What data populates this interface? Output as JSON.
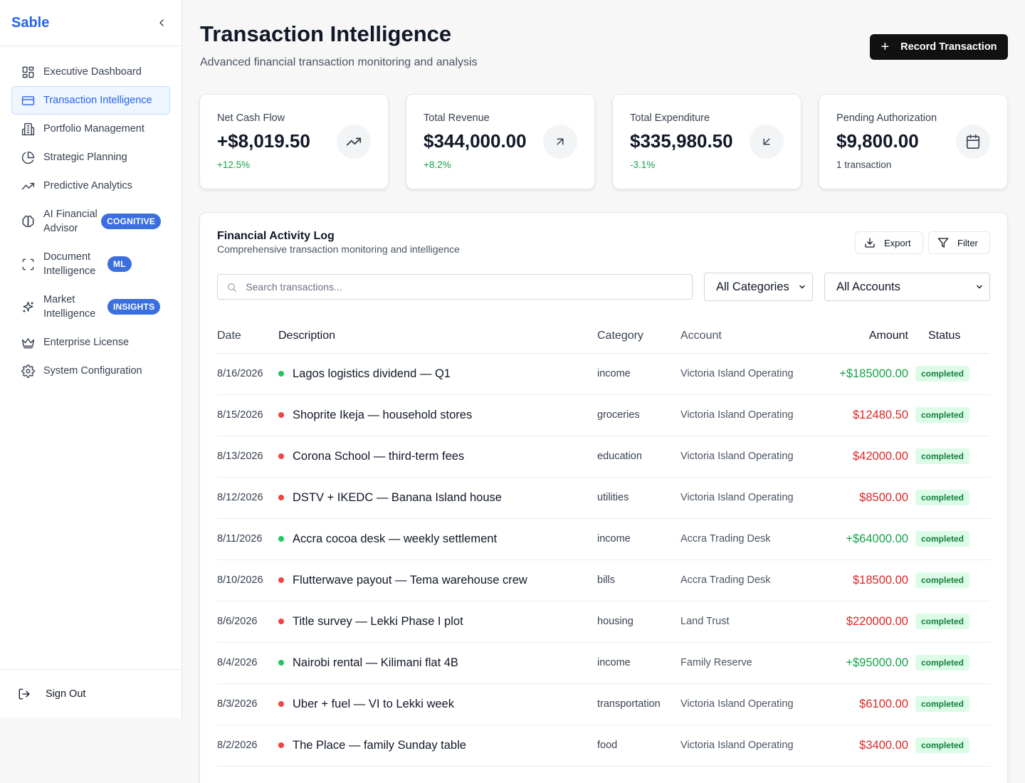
{
  "sidebar": {
    "brand": "Sable",
    "items": [
      {
        "label": "Executive Dashboard",
        "icon": "dashboard-icon",
        "active": false
      },
      {
        "label": "Transaction Intelligence",
        "icon": "credit-card-icon",
        "active": true
      },
      {
        "label": "Portfolio Management",
        "icon": "building-icon",
        "active": false
      },
      {
        "label": "Strategic Planning",
        "icon": "pie-chart-icon",
        "active": false
      },
      {
        "label": "Predictive Analytics",
        "icon": "trending-up-icon",
        "active": false
      },
      {
        "label": "AI Financial Advisor",
        "icon": "brain-icon",
        "badge": "COGNITIVE"
      },
      {
        "label": "Document Intelligence",
        "icon": "scan-icon",
        "badge": "ML"
      },
      {
        "label": "Market Intelligence",
        "icon": "sparkles-icon",
        "badge": "INSIGHTS"
      },
      {
        "label": "Enterprise License",
        "icon": "crown-icon"
      },
      {
        "label": "System Configuration",
        "icon": "gear-icon"
      }
    ],
    "sign_out": "Sign Out"
  },
  "header": {
    "title": "Transaction Intelligence",
    "subtitle": "Advanced financial transaction monitoring and analysis",
    "record_button": "Record Transaction"
  },
  "stats": [
    {
      "label": "Net Cash Flow",
      "value": "+$8,019.50",
      "change": "+12.5%",
      "icon": "trending-up-icon"
    },
    {
      "label": "Total Revenue",
      "value": "$344,000.00",
      "change": "+8.2%",
      "icon": "arrow-up-right-icon"
    },
    {
      "label": "Total Expenditure",
      "value": "$335,980.50",
      "change": "-3.1%",
      "icon": "arrow-down-left-icon"
    },
    {
      "label": "Pending Authorization",
      "value": "$9,800.00",
      "change": "1 transaction",
      "icon": "calendar-icon"
    }
  ],
  "log": {
    "title": "Financial Activity Log",
    "subtitle": "Comprehensive transaction monitoring and intelligence",
    "export_label": "Export",
    "filter_label": "Filter",
    "search_placeholder": "Search transactions...",
    "category_select": "All Categories",
    "account_select": "All Accounts",
    "columns": [
      "Date",
      "Description",
      "Category",
      "Account",
      "Amount",
      "Status"
    ],
    "rows": [
      {
        "date": "8/16/2026",
        "desc": "Lagos logistics dividend — Q1",
        "category": "income",
        "account": "Victoria Island Operating",
        "amount": "+$185000.00",
        "type": "credit",
        "status": "completed"
      },
      {
        "date": "8/15/2026",
        "desc": "Shoprite Ikeja — household stores",
        "category": "groceries",
        "account": "Victoria Island Operating",
        "amount": "$12480.50",
        "type": "debit",
        "status": "completed"
      },
      {
        "date": "8/13/2026",
        "desc": "Corona School — third-term fees",
        "category": "education",
        "account": "Victoria Island Operating",
        "amount": "$42000.00",
        "type": "debit",
        "status": "completed"
      },
      {
        "date": "8/12/2026",
        "desc": "DSTV + IKEDC — Banana Island house",
        "category": "utilities",
        "account": "Victoria Island Operating",
        "amount": "$8500.00",
        "type": "debit",
        "status": "completed"
      },
      {
        "date": "8/11/2026",
        "desc": "Accra cocoa desk — weekly settlement",
        "category": "income",
        "account": "Accra Trading Desk",
        "amount": "+$64000.00",
        "type": "credit",
        "status": "completed"
      },
      {
        "date": "8/10/2026",
        "desc": "Flutterwave payout — Tema warehouse crew",
        "category": "bills",
        "account": "Accra Trading Desk",
        "amount": "$18500.00",
        "type": "debit",
        "status": "completed"
      },
      {
        "date": "8/6/2026",
        "desc": "Title survey — Lekki Phase I plot",
        "category": "housing",
        "account": "Land Trust",
        "amount": "$220000.00",
        "type": "debit",
        "status": "completed"
      },
      {
        "date": "8/4/2026",
        "desc": "Nairobi rental — Kilimani flat 4B",
        "category": "income",
        "account": "Family Reserve",
        "amount": "+$95000.00",
        "type": "credit",
        "status": "completed"
      },
      {
        "date": "8/3/2026",
        "desc": "Uber + fuel — VI to Lekki week",
        "category": "transportation",
        "account": "Victoria Island Operating",
        "amount": "$6100.00",
        "type": "debit",
        "status": "completed"
      },
      {
        "date": "8/2/2026",
        "desc": "The Place — family Sunday table",
        "category": "food",
        "account": "Victoria Island Operating",
        "amount": "$3400.00",
        "type": "debit",
        "status": "completed"
      }
    ]
  },
  "colors": {
    "accent": "#2563eb",
    "credit": "#16a34a",
    "debit": "#dc2626",
    "badge": "#3b6fe0"
  }
}
